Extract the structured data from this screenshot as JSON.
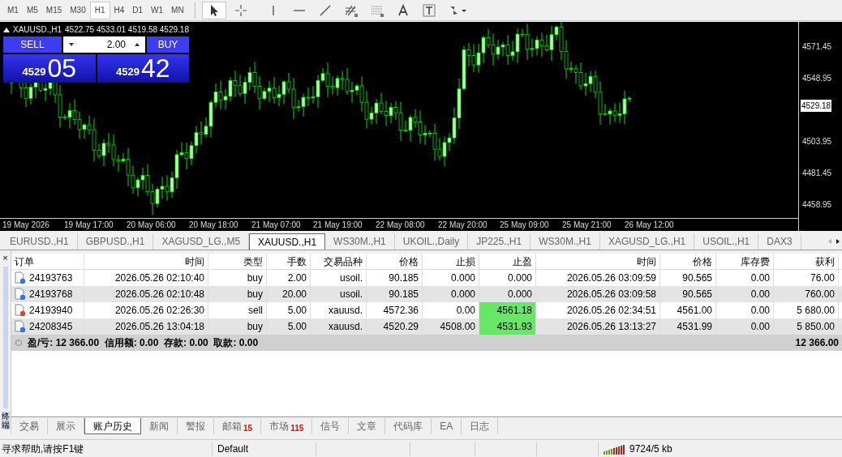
{
  "toolbar": {
    "timeframes": [
      {
        "label": "M1",
        "selected": false
      },
      {
        "label": "M5",
        "selected": false
      },
      {
        "label": "M15",
        "selected": false
      },
      {
        "label": "M30",
        "selected": false
      },
      {
        "label": "H1",
        "selected": true
      },
      {
        "label": "H4",
        "selected": false
      },
      {
        "label": "D1",
        "selected": false
      },
      {
        "label": "W1",
        "selected": false
      },
      {
        "label": "MN",
        "selected": false
      }
    ],
    "tools": [
      {
        "kind": "cursor",
        "selected": true
      },
      {
        "kind": "crosshair",
        "selected": false
      },
      {
        "kind": "vline",
        "selected": false
      },
      {
        "kind": "hline",
        "selected": false
      },
      {
        "kind": "trendline",
        "selected": false
      },
      {
        "kind": "fibo",
        "selected": false
      },
      {
        "kind": "grid",
        "selected": false
      },
      {
        "kind": "text",
        "selected": false
      },
      {
        "kind": "label",
        "selected": false
      },
      {
        "kind": "arrows",
        "selected": false
      }
    ]
  },
  "chart": {
    "header": "XAUUSD.,H1",
    "ohlc": "4522.75 4533.01 4519.58 4529.18",
    "trade_panel": {
      "sell_label": "SELL",
      "buy_label": "BUY",
      "volume": "2.00",
      "bid_big": "4529",
      "bid_small": "05",
      "ask_big": "4529",
      "ask_small": "42"
    },
    "price_labels": [
      "4571.45",
      "4548.95",
      "4503.95",
      "4481.45",
      "4458.95"
    ],
    "current_price": "4529.18",
    "time_labels": [
      "19 May 2026",
      "19 May 17:00",
      "20 May 06:00",
      "20 May 18:00",
      "21 May 07:00",
      "21 May 19:00",
      "22 May 08:00",
      "22 May 20:00",
      "25 May 09:00",
      "25 May 21:00",
      "26 May 12:00"
    ]
  },
  "chart_tabs": [
    {
      "label": "EURUSD.,H1",
      "selected": false
    },
    {
      "label": "GBPUSD.,H1",
      "selected": false
    },
    {
      "label": "XAGUSD_LG.,M5",
      "selected": false
    },
    {
      "label": "XAUUSD.,H1",
      "selected": true
    },
    {
      "label": "WS30M.,H1",
      "selected": false
    },
    {
      "label": "UKOIL.,Daily",
      "selected": false
    },
    {
      "label": "JP225.,H1",
      "selected": false
    },
    {
      "label": "WS30M.,H1",
      "selected": false
    },
    {
      "label": "XAGUSD_LG.,H1",
      "selected": false
    },
    {
      "label": "USOIL.,H1",
      "selected": false
    },
    {
      "label": "DAX3",
      "selected": false
    }
  ],
  "terminal": {
    "close": "×",
    "side_label": "终端",
    "columns": [
      "订单",
      "时间",
      "类型",
      "手数",
      "交易品种",
      "价格",
      "止损",
      "止盈",
      "时间",
      "价格",
      "库存费",
      "获利"
    ],
    "rows": [
      {
        "kind": "buy",
        "cells": [
          "24193763",
          "2026.05.26 02:10:40",
          "buy",
          "2.00",
          "usoil.",
          "90.185",
          "0.000",
          "0.000",
          "2026.05.26 03:09:59",
          "90.565",
          "0.00",
          "76.00"
        ],
        "tp_hit": false
      },
      {
        "kind": "buy",
        "cells": [
          "24193768",
          "2026.05.26 02:10:48",
          "buy",
          "20.00",
          "usoil.",
          "90.185",
          "0.000",
          "0.000",
          "2026.05.26 03:09:58",
          "90.565",
          "0.00",
          "760.00"
        ],
        "tp_hit": false
      },
      {
        "kind": "sell",
        "cells": [
          "24193940",
          "2026.05.26 02:26:30",
          "sell",
          "5.00",
          "xauusd.",
          "4572.36",
          "0.00",
          "4561.18",
          "2026.05.26 02:34:51",
          "4561.00",
          "0.00",
          "5 680.00"
        ],
        "tp_hit": true
      },
      {
        "kind": "buy",
        "cells": [
          "24208345",
          "2026.05.26 13:04:18",
          "buy",
          "5.00",
          "xauusd.",
          "4520.29",
          "4508.00",
          "4531.93",
          "2026.05.26 13:13:27",
          "4531.99",
          "0.00",
          "5 850.00"
        ],
        "tp_hit": true
      }
    ],
    "summary": {
      "text": "盈/亏: 12 366.00  信用额: 0.00  存款: 0.00  取款: 0.00",
      "total": "12 366.00"
    },
    "tabs": [
      {
        "label": "交易",
        "selected": false
      },
      {
        "label": "展示",
        "selected": false
      },
      {
        "label": "账户历史",
        "selected": true
      },
      {
        "label": "新闻",
        "selected": false
      },
      {
        "label": "警报",
        "selected": false
      },
      {
        "label": "邮箱",
        "badge": "15",
        "selected": false
      },
      {
        "label": "市场",
        "badge": "115",
        "selected": false
      },
      {
        "label": "信号",
        "selected": false
      },
      {
        "label": "文章",
        "selected": false
      },
      {
        "label": "代码库",
        "selected": false
      },
      {
        "label": "EA",
        "selected": false
      },
      {
        "label": "日志",
        "selected": false
      }
    ]
  },
  "status_bar": {
    "help": "寻求帮助,请按F1键",
    "profile": "Default",
    "traffic": "9724/5 kb"
  }
}
